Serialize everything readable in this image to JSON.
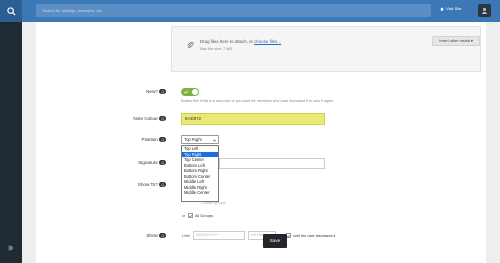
{
  "header": {
    "search_placeholder": "Search for settings, members, etc",
    "visit_site_label": "Visit Site"
  },
  "attach": {
    "drag_text": "Drag files here to attach, or ",
    "choose_link": "choose files...",
    "max_size": "Max file size: 7 MB",
    "insert_media_label": "Insert other media ▾"
  },
  "form": {
    "new_label": "New?",
    "new_help": "Enable this if this is a new note or you want the members who have dismissed it to view it again.",
    "note_colour_label": "Note Colour",
    "note_colour_value": "EAE972",
    "position_label": "Position",
    "position_selected": "Top Right",
    "position_options": [
      "Top Left",
      "Top Right",
      "Top Center",
      "Bottom Left",
      "Bottom Right",
      "Bottom Center",
      "Middle Left",
      "Middle Right",
      "Middle Center"
    ],
    "signature_label": "Signature",
    "show_to_label": "Show To?",
    "all_groups_label": "All Groups",
    "or_text": "or",
    "show_label": "Show",
    "until_text": "Until",
    "date_placeholder": "MM/DD/YYYY",
    "time_placeholder": "HH:MM",
    "until_dismiss_label": "until the user dismisses it",
    "behind_text": "Choose groups",
    "save_label": "Save"
  },
  "badges": {
    "new": "Q",
    "note_colour": "Q",
    "position": "Q",
    "signature": "Q",
    "show_to": "Q",
    "show": "Q"
  },
  "colors": {
    "topbar": "#3d78b6",
    "note_colour": "#eae972",
    "selected_option": "#1e6dd9"
  }
}
